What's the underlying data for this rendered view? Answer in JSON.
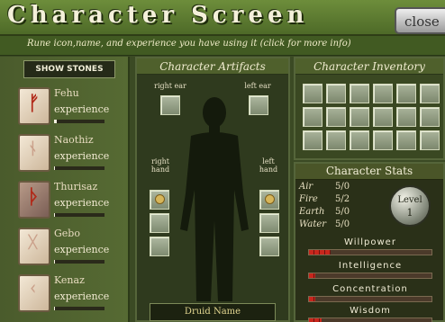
{
  "header": {
    "title": "Character Screen",
    "close_label": "close",
    "subtitle": "Rune icon,name, and experience you have using it (click for more info)"
  },
  "left": {
    "show_stones_label": "SHOW STONES",
    "stones": [
      {
        "name": "Fehu",
        "experience_label": "experience",
        "progress": 0.05,
        "selected": false
      },
      {
        "name": "Naothiz",
        "experience_label": "experience",
        "progress": 0.02,
        "selected": false
      },
      {
        "name": "Thurisaz",
        "experience_label": "experience",
        "progress": 0.02,
        "selected": true
      },
      {
        "name": "Gebo",
        "experience_label": "experience",
        "progress": 0.02,
        "selected": false
      },
      {
        "name": "Kenaz",
        "experience_label": "experience",
        "progress": 0.02,
        "selected": false
      }
    ]
  },
  "artifacts": {
    "title": "Character Artifacts",
    "right_ear": "right ear",
    "left_ear": "left ear",
    "right_hand": "right hand",
    "left_hand": "left hand",
    "druid_name": "Druid Name"
  },
  "inventory": {
    "title": "Character Inventory",
    "rows": 3,
    "cols": 6
  },
  "stats": {
    "title": "Character Stats",
    "elements": [
      {
        "name": "Air",
        "value": "5/0"
      },
      {
        "name": "Fire",
        "value": "5/2"
      },
      {
        "name": "Earth",
        "value": "5/0"
      },
      {
        "name": "Water",
        "value": "5/0"
      }
    ],
    "level_label": "Level",
    "level_value": "1",
    "attributes": [
      {
        "name": "Willpower",
        "fill": 0.18
      },
      {
        "name": "Intelligence",
        "fill": 0.05
      },
      {
        "name": "Concentration",
        "fill": 0.05
      },
      {
        "name": "Wisdom",
        "fill": 0.1
      }
    ]
  },
  "colors": {
    "title_bar": "#5e7c32",
    "panel_bg": "#2f3a1e",
    "bar_fill": "#c8261c"
  }
}
